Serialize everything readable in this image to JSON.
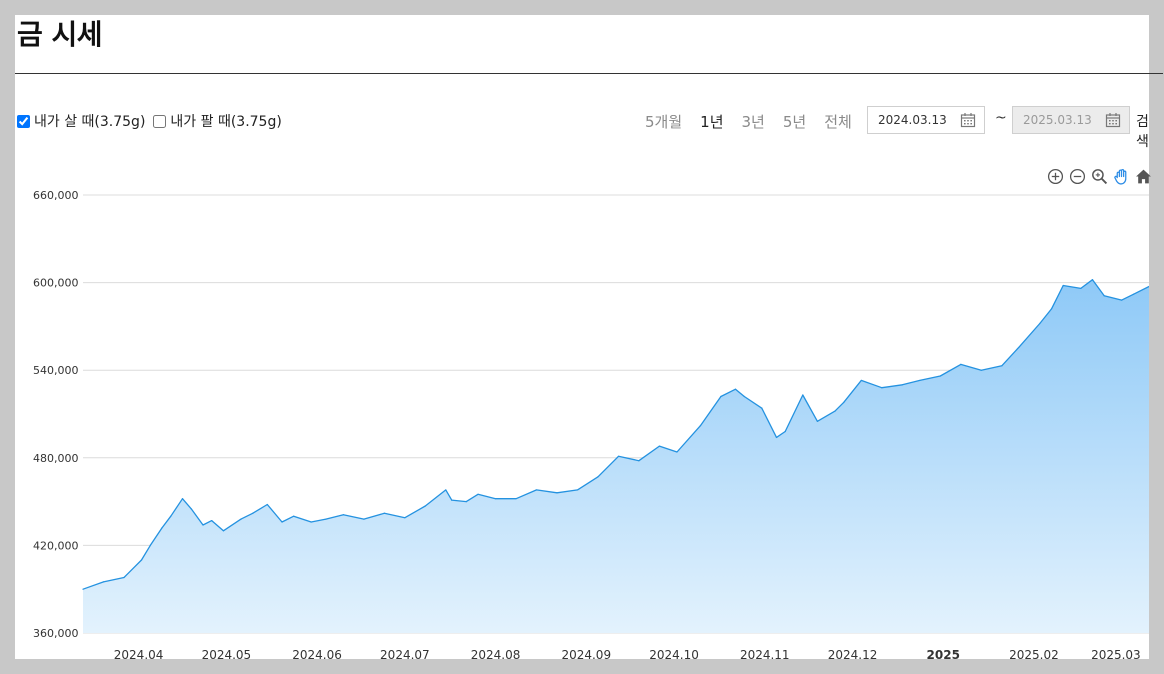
{
  "page": {
    "title": "금 시세"
  },
  "options": {
    "buy": {
      "label": "내가 살 때(3.75g)",
      "checked": true
    },
    "sell": {
      "label": "내가 팔 때(3.75g)",
      "checked": false
    }
  },
  "periods": [
    "5개월",
    "1년",
    "3년",
    "5년",
    "전체"
  ],
  "active_period": "1년",
  "date_range": {
    "start": "2024.03.13",
    "separator": "~",
    "end": "2025.03.13",
    "search_label": "검색"
  },
  "toolbar": {
    "icons": [
      "zoom-in-icon",
      "zoom-out-icon",
      "magnifier-icon",
      "pan-hand-icon",
      "home-icon"
    ],
    "accent": "#2e8de6"
  },
  "chart_data": {
    "type": "area",
    "title": "",
    "xlabel": "",
    "ylabel": "",
    "ylim": [
      360000,
      660000
    ],
    "yticks": [
      "660,000",
      "600,000",
      "540,000",
      "480,000",
      "420,000",
      "360,000"
    ],
    "xticks": [
      "2024.04",
      "2024.05",
      "2024.06",
      "2024.07",
      "2024.08",
      "2024.09",
      "2024.10",
      "2024.11",
      "2024.12",
      "2025",
      "2025.02",
      "2025.03"
    ],
    "x_range": [
      "2024.03.13",
      "2025.03.13"
    ],
    "grid": true,
    "colors": {
      "line": "#2492e0",
      "fill_top": "#8ec9f7",
      "fill_bottom": "#e3f2fd"
    },
    "series": [
      {
        "x": [
          "2024.03.13",
          "2024.03.20",
          "2024.03.27",
          "2024.04.02",
          "2024.04.05",
          "2024.04.09",
          "2024.04.12",
          "2024.04.16",
          "2024.04.19",
          "2024.04.23",
          "2024.04.26",
          "2024.04.30",
          "2024.05.06",
          "2024.05.10",
          "2024.05.15",
          "2024.05.20",
          "2024.05.24",
          "2024.05.30",
          "2024.06.04",
          "2024.06.10",
          "2024.06.17",
          "2024.06.24",
          "2024.07.01",
          "2024.07.08",
          "2024.07.15",
          "2024.07.17",
          "2024.07.22",
          "2024.07.26",
          "2024.08.01",
          "2024.08.08",
          "2024.08.15",
          "2024.08.22",
          "2024.08.29",
          "2024.09.05",
          "2024.09.12",
          "2024.09.19",
          "2024.09.26",
          "2024.10.02",
          "2024.10.10",
          "2024.10.17",
          "2024.10.22",
          "2024.10.25",
          "2024.10.31",
          "2024.11.05",
          "2024.11.08",
          "2024.11.14",
          "2024.11.19",
          "2024.11.25",
          "2024.11.28",
          "2024.12.04",
          "2024.12.11",
          "2024.12.18",
          "2024.12.24",
          "2024.12.31",
          "2025.01.07",
          "2025.01.14",
          "2025.01.21",
          "2025.01.27",
          "2025.02.03",
          "2025.02.07",
          "2025.02.11",
          "2025.02.17",
          "2025.02.21",
          "2025.02.25",
          "2025.03.03",
          "2025.03.07",
          "2025.03.13"
        ],
        "values": [
          390000,
          395000,
          398000,
          410000,
          420000,
          432000,
          440000,
          452000,
          445000,
          434000,
          437000,
          430000,
          438000,
          442000,
          448000,
          436000,
          440000,
          436000,
          438000,
          441000,
          438000,
          442000,
          439000,
          447000,
          458000,
          451000,
          450000,
          455000,
          452000,
          452000,
          458000,
          456000,
          458000,
          467000,
          481000,
          478000,
          488000,
          484000,
          502000,
          522000,
          527000,
          522000,
          514000,
          494000,
          498000,
          523000,
          505000,
          512000,
          518000,
          533000,
          528000,
          530000,
          533000,
          536000,
          544000,
          540000,
          543000,
          556000,
          572000,
          582000,
          598000,
          596000,
          602000,
          591000,
          588000,
          592000,
          598000
        ]
      }
    ]
  }
}
